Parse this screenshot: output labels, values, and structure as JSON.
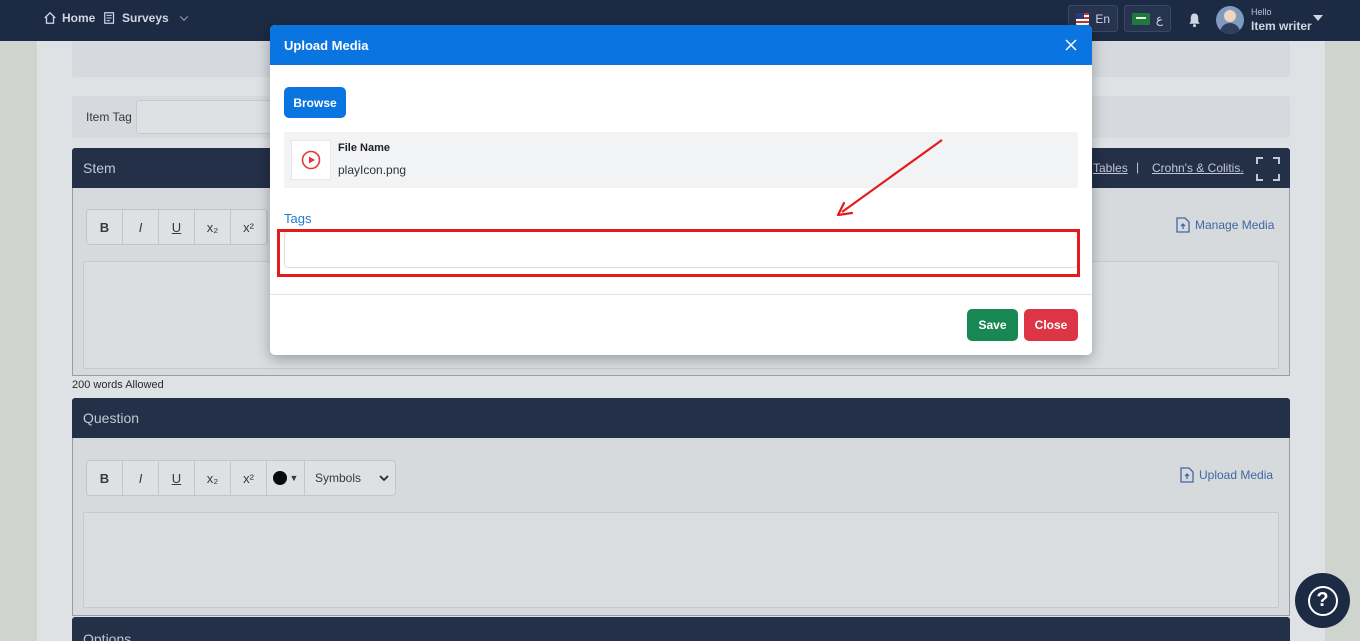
{
  "navbar": {
    "home_label": "Home",
    "surveys_label": "Surveys",
    "lang_en": "En",
    "lang_ar": "ع",
    "user_greeting": "Hello",
    "user_name": "Item writer"
  },
  "background": {
    "item_tag_label": "Item Tag",
    "stem_title": "Stem",
    "stem_links": [
      "Tables",
      "|",
      "Crohn's & Colitis."
    ],
    "words_allowed": "200 words Allowed",
    "question_title": "Question",
    "options_title": "Options",
    "manage_media_label": "Manage Media",
    "upload_media_label": "Upload Media",
    "toolbar": {
      "bold": "B",
      "italic": "I",
      "underline": "U",
      "subscript": "x₂",
      "superscript": "x²",
      "symbols": "Symbols"
    }
  },
  "modal": {
    "title": "Upload Media",
    "browse_label": "Browse",
    "file_name_label": "File Name",
    "file_name_value": "playIcon.png",
    "tags_label": "Tags",
    "tags_value": "",
    "save_label": "Save",
    "close_label": "Close"
  },
  "colors": {
    "primary": "#0a74e0",
    "navbar": "#1d2a44",
    "save": "#198754",
    "close": "#dc3545",
    "annotation": "#e31b1b"
  }
}
